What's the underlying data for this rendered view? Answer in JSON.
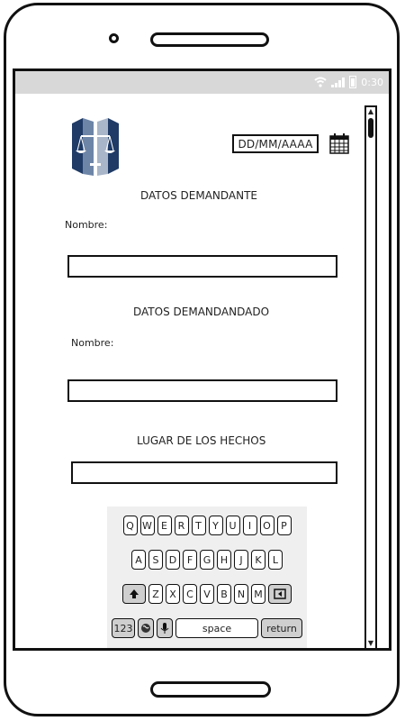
{
  "status_bar": {
    "time": "0:30"
  },
  "form": {
    "date_placeholder": "DD/MM/AAAA",
    "demandante": {
      "title": "DATOS DEMANDANTE",
      "name_label": "Nombre:"
    },
    "demandado": {
      "title": "DATOS DEMANDANDADO",
      "name_label": "Nombre:"
    },
    "lugar": {
      "title": "LUGAR DE LOS HECHOS"
    }
  },
  "keyboard": {
    "row1": [
      "Q",
      "W",
      "E",
      "R",
      "T",
      "Y",
      "U",
      "I",
      "O",
      "P"
    ],
    "row2": [
      "A",
      "S",
      "D",
      "F",
      "G",
      "H",
      "J",
      "K",
      "L"
    ],
    "row3": [
      "Z",
      "X",
      "C",
      "V",
      "B",
      "N",
      "M"
    ],
    "numbers_label": "123",
    "space_label": "space",
    "return_label": "return"
  },
  "icons": [
    "wifi-icon",
    "signal-icon",
    "battery-icon",
    "justice-logo",
    "calendar-icon",
    "shift-icon",
    "backspace-icon",
    "globe-icon",
    "mic-icon"
  ]
}
